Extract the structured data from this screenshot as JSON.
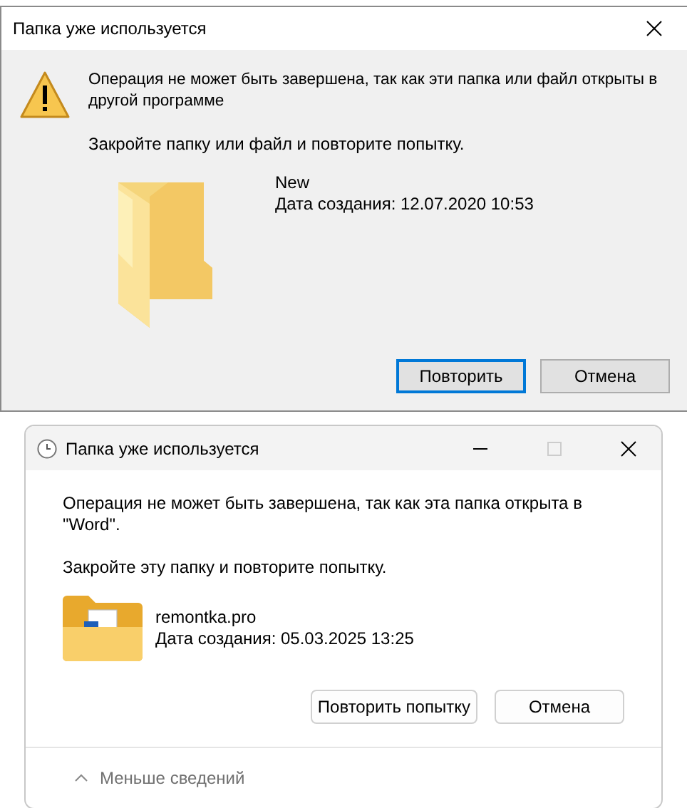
{
  "dialogs": [
    {
      "title": "Папка уже используется",
      "message": "Операция не может быть завершена, так как эти папка или файл открыты в другой программе",
      "instruction": "Закройте папку или файл и повторите попытку.",
      "item": {
        "name": "New",
        "created": "Дата создания: 12.07.2020 10:53"
      },
      "buttons": [
        {
          "label": "Повторить",
          "focused": true
        },
        {
          "label": "Отмена",
          "focused": false
        }
      ]
    },
    {
      "title": "Папка уже используется",
      "message": "Операция не может быть завершена, так как эта папка открыта в \"Word\".",
      "instruction": "Закройте эту папку и повторите попытку.",
      "item": {
        "name": "remontka.pro",
        "created": "Дата создания: 05.03.2025 13:25"
      },
      "buttons": [
        {
          "label": "Повторить попытку",
          "focused": false
        },
        {
          "label": "Отмена",
          "focused": false
        }
      ],
      "details_toggle": {
        "label": "Меньше сведений",
        "expanded": true
      }
    }
  ]
}
